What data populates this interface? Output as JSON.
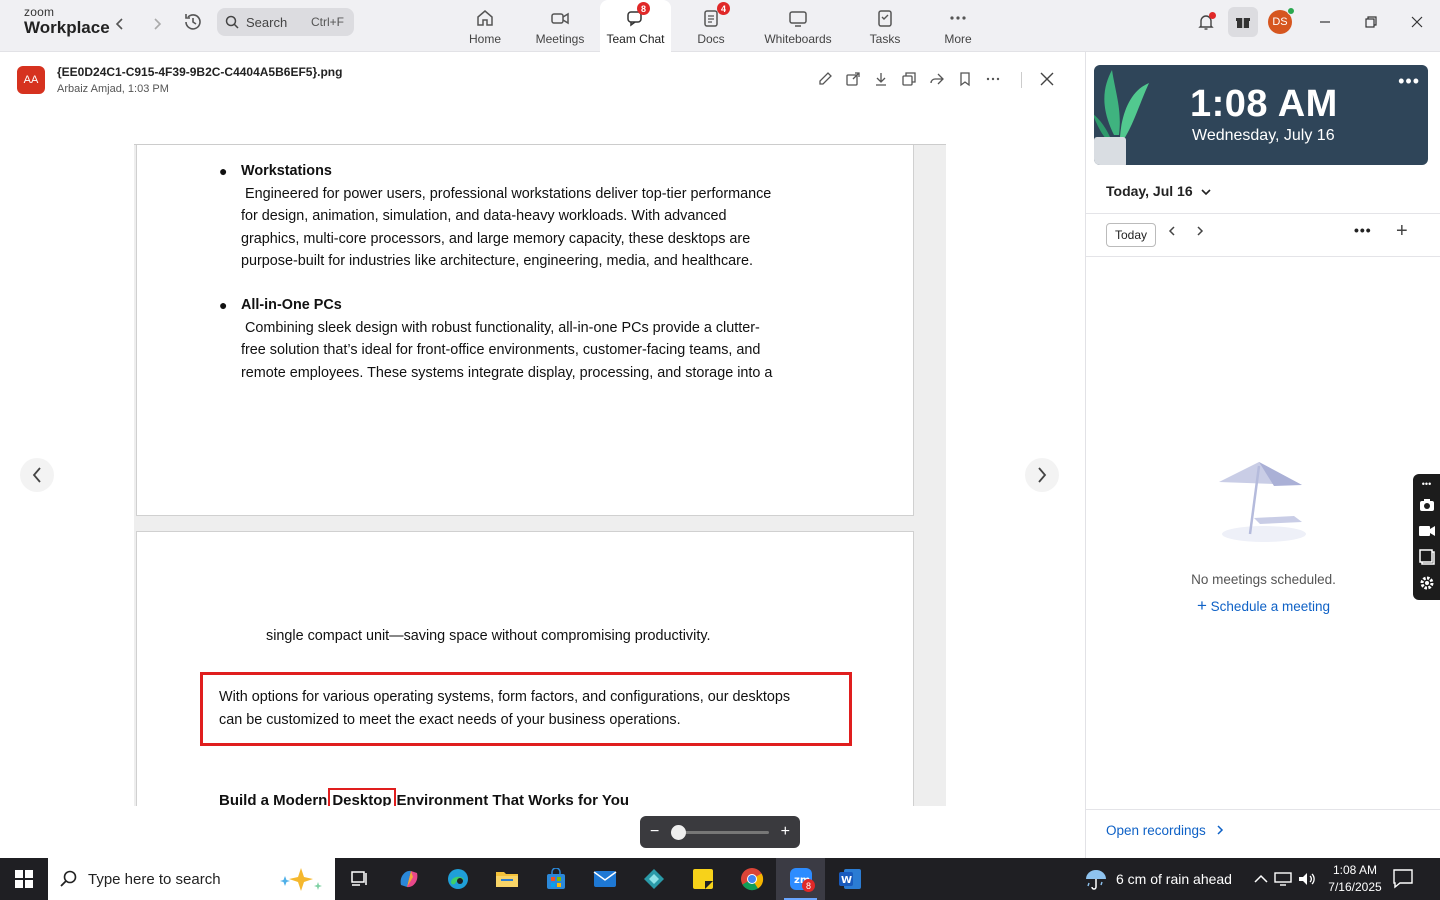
{
  "app": {
    "brand_small": "zoom",
    "brand_large": "Workplace",
    "search_placeholder": "Search",
    "search_shortcut": "Ctrl+F"
  },
  "nav_tabs": [
    {
      "label": "Home",
      "icon": "home-icon",
      "badge": ""
    },
    {
      "label": "Meetings",
      "icon": "video-icon",
      "badge": ""
    },
    {
      "label": "Team Chat",
      "icon": "chat-icon",
      "badge": "8"
    },
    {
      "label": "Docs",
      "icon": "docs-icon",
      "badge": "4"
    },
    {
      "label": "Whiteboards",
      "icon": "whiteboard-icon",
      "badge": ""
    },
    {
      "label": "Tasks",
      "icon": "tasks-icon",
      "badge": ""
    },
    {
      "label": "More",
      "icon": "more-icon",
      "badge": ""
    }
  ],
  "user": {
    "initials": "DS",
    "status_color": "#2aa84f"
  },
  "viewer": {
    "sender_initials": "AA",
    "file_name": "{EE0D24C1-C915-4F39-9B2C-C4404A5B6EF5}.png",
    "meta": "Arbaiz Amjad, 1:03 PM"
  },
  "doc": {
    "bullet1_title": "Workstations",
    "bullet1_line1": " Engineered for power users, professional workstations deliver top-tier performance",
    "bullet1_line2": "for design, animation, simulation, and data-heavy workloads. With advanced",
    "bullet1_line3": "graphics, multi-core processors, and large memory capacity, these desktops are",
    "bullet1_line4": "purpose-built for industries like architecture, engineering, media, and healthcare.",
    "bullet2_title": "All-in-One PCs",
    "bullet2_line1": " Combining sleek design with robust functionality, all-in-one PCs provide a clutter-",
    "bullet2_line2": "free solution that’s ideal for front-office environments, customer-facing teams, and",
    "bullet2_line3": "remote employees. These systems integrate display, processing, and storage into a",
    "page2_line1": "single compact unit—saving space without compromising productivity.",
    "highlight_line1": "With options for various operating systems, form factors, and configurations, our desktops",
    "highlight_line2": "can be customized to meet the exact needs of your business operations.",
    "heading_before": "Build a Modern",
    "heading_boxed": "Desktop",
    "heading_after": "Environment That Works for You",
    "highlight_color": "#e01e1e"
  },
  "zoom": {
    "minus": "−",
    "plus": "+",
    "level": 0.0
  },
  "calendar": {
    "time": "1:08 AM",
    "date": "Wednesday, July 16",
    "header": "Today, Jul 16",
    "today_button": "Today",
    "empty_text": "No meetings scheduled.",
    "schedule_link": "Schedule a meeting",
    "open_recordings": "Open recordings"
  },
  "taskbar": {
    "search_placeholder": "Type here to search",
    "weather": "6 cm of rain ahead",
    "time": "1:08 AM",
    "date": "7/16/2025",
    "zoom_badge": "8",
    "apps": [
      "task-view-icon",
      "copilot-icon",
      "edge-icon",
      "file-explorer-icon",
      "store-icon",
      "mail-icon",
      "app-icon",
      "sticky-notes-icon",
      "chrome-icon",
      "zoom-icon",
      "word-icon"
    ]
  }
}
